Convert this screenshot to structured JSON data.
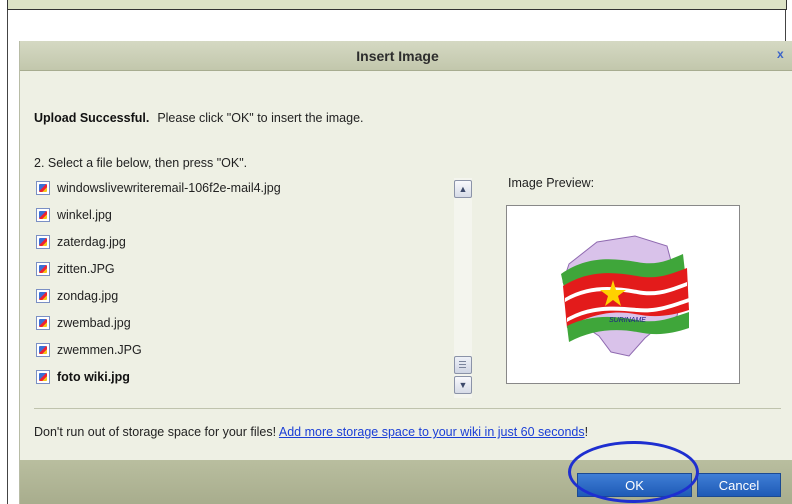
{
  "dialog": {
    "title": "Insert Image",
    "close_glyph": "x"
  },
  "status": {
    "strong": "Upload Successful.",
    "message": "Please click \"OK\" to insert the image."
  },
  "instructions": "2. Select a file below, then press \"OK\".",
  "files": [
    {
      "name": "windowslivewriteremail-106f2e-mail4.jpg",
      "icon": "image-file-icon",
      "selected": false
    },
    {
      "name": "winkel.jpg",
      "icon": "image-file-icon",
      "selected": false
    },
    {
      "name": "zaterdag.jpg",
      "icon": "image-file-icon",
      "selected": false
    },
    {
      "name": "zitten.JPG",
      "icon": "image-file-icon",
      "selected": false
    },
    {
      "name": "zondag.jpg",
      "icon": "image-file-icon",
      "selected": false
    },
    {
      "name": "zwembad.jpg",
      "icon": "image-file-icon",
      "selected": false
    },
    {
      "name": "zwemmen.JPG",
      "icon": "image-file-icon",
      "selected": false
    },
    {
      "name": "foto wiki.jpg",
      "icon": "image-file-icon",
      "selected": true
    }
  ],
  "preview": {
    "label": "Image Preview:",
    "image_caption": "SURINAME"
  },
  "storage": {
    "text": "Don't run out of storage space for your files! ",
    "link": "Add more storage space to your wiki in just 60 seconds",
    "suffix": "!"
  },
  "buttons": {
    "ok": "OK",
    "cancel": "Cancel"
  },
  "colors": {
    "dialog_bg": "#eef0e4",
    "titlebar": "#c9cdb3",
    "button_blue": "#2a67c4",
    "annotation_circle": "#1e2fd0",
    "link": "#1a3ed6"
  }
}
